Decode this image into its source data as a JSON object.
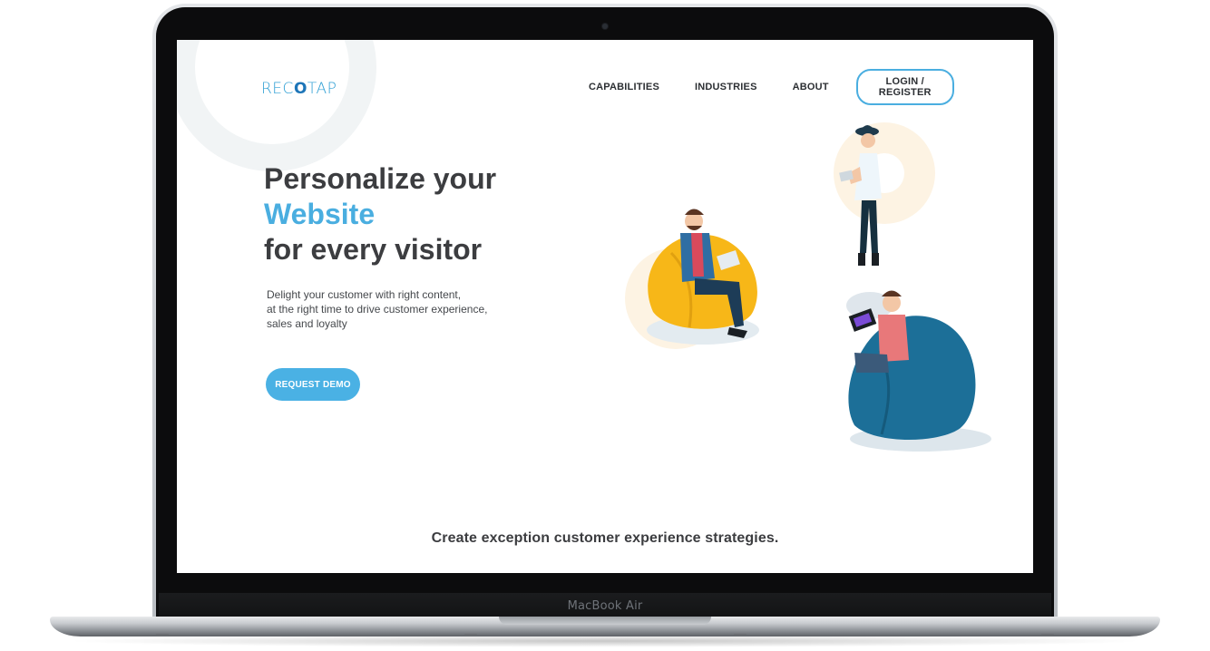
{
  "device": {
    "label": "MacBook Air"
  },
  "site": {
    "logo": {
      "prefix": "REC",
      "mark": "O",
      "suffix": "TAP"
    },
    "nav": [
      {
        "label": "CAPABILITIES"
      },
      {
        "label": "INDUSTRIES"
      },
      {
        "label": "ABOUT"
      }
    ],
    "login_label": "LOGIN / REGISTER",
    "hero": {
      "line1": "Personalize your",
      "line2": "Website",
      "line3": "for every visitor",
      "sub1": "Delight your customer with right content,",
      "sub2": "at the right time to drive customer experience,",
      "sub3": "sales and loyalty",
      "cta_label": "REQUEST DEMO"
    },
    "tagline": "Create exception customer experience strategies."
  },
  "colors": {
    "accent": "#4aaee0",
    "text_dark": "#3c3d40",
    "beanbag_yellow": "#f7b718",
    "beanbag_blue": "#1c6f98"
  }
}
